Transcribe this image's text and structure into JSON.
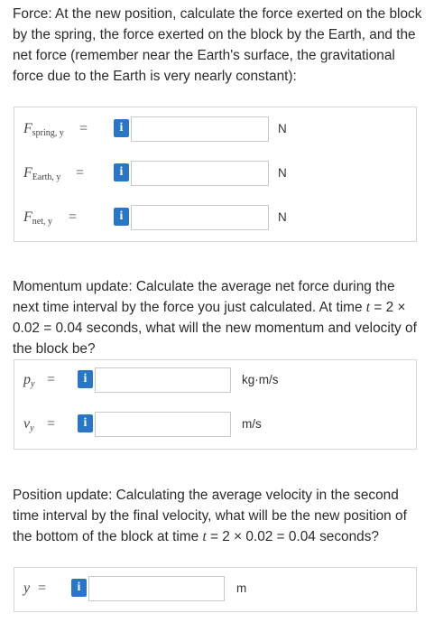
{
  "force_section": {
    "prompt": "Force: At the new position, calculate the force exerted on the block by the spring, the force exerted on the block by the Earth, and the net force (remember near the Earth's surface, the gravitational force due to the Earth is very nearly constant):",
    "rows": [
      {
        "symbol": "F",
        "subscript": "spring, y",
        "equals": "=",
        "info": "i",
        "value": "",
        "unit": "N"
      },
      {
        "symbol": "F",
        "subscript": "Earth, y",
        "equals": "=",
        "info": "i",
        "value": "",
        "unit": "N"
      },
      {
        "symbol": "F",
        "subscript": "net, y",
        "equals": "=",
        "info": "i",
        "value": "",
        "unit": "N"
      }
    ]
  },
  "momentum_section": {
    "prompt_a": "Momentum update: Calculate the average net force during the next time interval by the force you just calculated. At time ",
    "t": "t",
    "prompt_b": " = 2 × 0.02 = 0.04 seconds, what will the new momentum and velocity of the block be?",
    "rows": [
      {
        "symbol": "p",
        "subscript": "y",
        "equals": "=",
        "info": "i",
        "value": "",
        "unit": "kg·m/s"
      },
      {
        "symbol": "v",
        "subscript": "y",
        "equals": "=",
        "info": "i",
        "value": "",
        "unit": "m/s"
      }
    ]
  },
  "position_section": {
    "prompt_a": "Position update: Calculating the average velocity in the second time interval by the final velocity, what will be the new position of the bottom of the block at time ",
    "t": "t",
    "prompt_b": " = 2 × 0.02 = 0.04 seconds?",
    "rows": [
      {
        "symbol": "y",
        "equals": "=",
        "info": "i",
        "value": "",
        "unit": "m"
      }
    ]
  }
}
